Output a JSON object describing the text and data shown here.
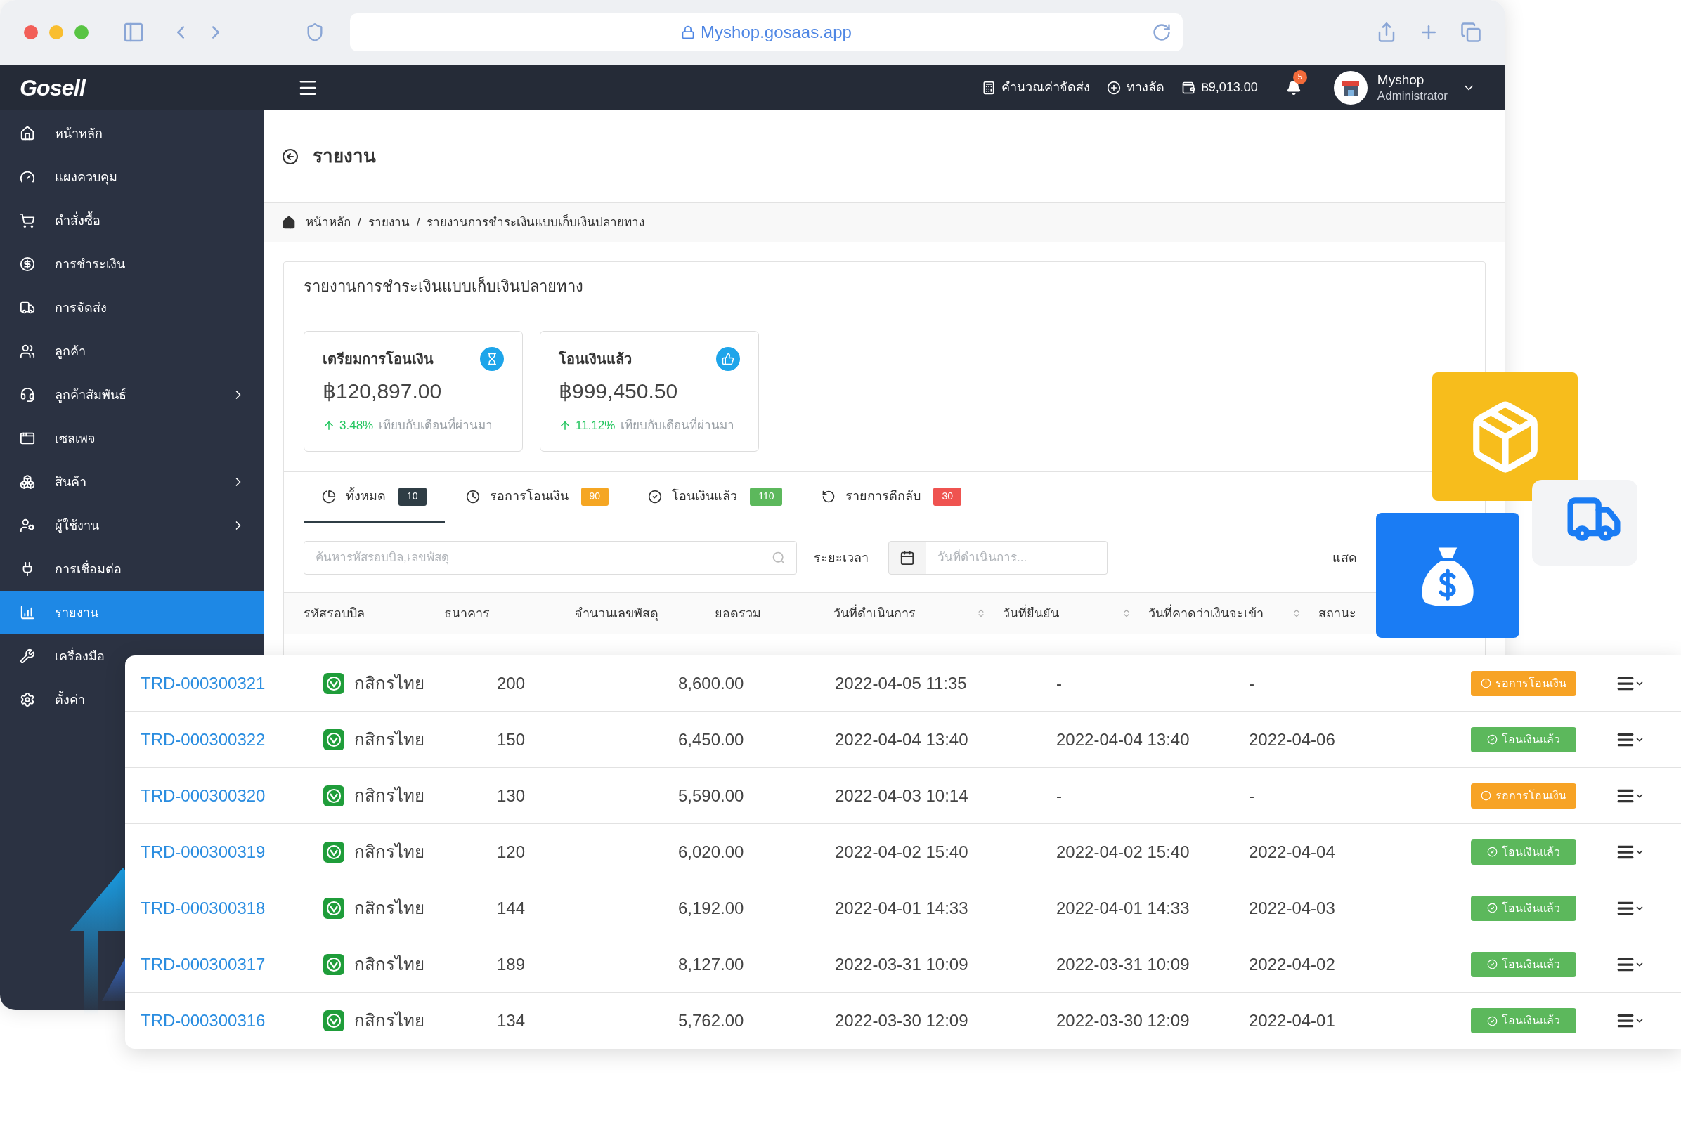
{
  "browser": {
    "url": "Myshop.gosaas.app"
  },
  "header": {
    "logo": "Gosell",
    "actions": [
      {
        "label": "คำนวณค่าจัดส่ง"
      },
      {
        "label": "ทางลัด"
      },
      {
        "label": "฿9,013.00"
      }
    ],
    "notifications": "5",
    "user": {
      "name": "Myshop",
      "role": "Administrator"
    }
  },
  "sidebar": {
    "items": [
      {
        "label": "หน้าหลัก",
        "selected": false,
        "has_submenu": false
      },
      {
        "label": "แผงควบคุม",
        "selected": false,
        "has_submenu": false
      },
      {
        "label": "คำสั่งซื้อ",
        "selected": false,
        "has_submenu": false
      },
      {
        "label": "การชำระเงิน",
        "selected": false,
        "has_submenu": false
      },
      {
        "label": "การจัดส่ง",
        "selected": false,
        "has_submenu": false
      },
      {
        "label": "ลูกค้า",
        "selected": false,
        "has_submenu": false
      },
      {
        "label": "ลูกค้าสัมพันธ์",
        "selected": false,
        "has_submenu": true
      },
      {
        "label": "เซลเพจ",
        "selected": false,
        "has_submenu": false
      },
      {
        "label": "สินค้า",
        "selected": false,
        "has_submenu": true
      },
      {
        "label": "ผู้ใช้งาน",
        "selected": false,
        "has_submenu": true
      },
      {
        "label": "การเชื่อมต่อ",
        "selected": false,
        "has_submenu": false
      },
      {
        "label": "รายงาน",
        "selected": true,
        "has_submenu": false
      },
      {
        "label": "เครื่องมือ",
        "selected": false,
        "has_submenu": false
      },
      {
        "label": "ตั้งค่า",
        "selected": false,
        "has_submenu": false
      }
    ]
  },
  "page": {
    "title": "รายงาน",
    "separator": "/",
    "breadcrumb": [
      "หน้าหลัก",
      "รายงาน",
      "รายงานการชำระเงินแบบเก็บเงินปลายทาง"
    ]
  },
  "report": {
    "title": "รายงานการชำระเงินแบบเก็บเงินปลายทาง",
    "stats": [
      {
        "label": "เตรียมการโอนเงิน",
        "amount": "฿120,897.00",
        "change": "3.48%",
        "comparison": "เทียบกับเดือนที่ผ่านมา"
      },
      {
        "label": "โอนเงินแล้ว",
        "amount": "฿999,450.50",
        "change": "11.12%",
        "comparison": "เทียบกับเดือนที่ผ่านมา"
      }
    ],
    "tabs": [
      {
        "label": "ทั้งหมด",
        "count": "10",
        "color": "#2f3d45",
        "selected": true
      },
      {
        "label": "รอการโอนเงิน",
        "count": "90",
        "color": "#f5a623",
        "selected": false
      },
      {
        "label": "โอนเงินแล้ว",
        "count": "110",
        "color": "#5cb85c",
        "selected": false
      },
      {
        "label": "รายการตีกลับ",
        "count": "30",
        "color": "#ef5350",
        "selected": false
      }
    ],
    "search": {
      "placeholder": "ค้นหารหัสรอบบิล,เลขพัสดุ"
    },
    "period": {
      "label": "ระยะเวลา",
      "placeholder": "วันที่ดำเนินการ..."
    },
    "show_label": "แสด",
    "columns": [
      {
        "label": "รหัสรอบบิล",
        "sortable": false
      },
      {
        "label": "ธนาคาร",
        "sortable": false
      },
      {
        "label": "จำนวนเลขพัสดุ",
        "sortable": false
      },
      {
        "label": "ยอดรวม",
        "sortable": false
      },
      {
        "label": "วันที่ดำเนินการ",
        "sortable": true
      },
      {
        "label": "วันที่ยืนยัน",
        "sortable": true
      },
      {
        "label": "วันที่คาดว่าเงินจะเข้า",
        "sortable": true
      },
      {
        "label": "สถานะ",
        "sortable": false
      }
    ]
  },
  "rows": [
    {
      "id": "TRD-000300321",
      "bank": "กสิกรไทย",
      "parcels": "200",
      "total": "8,600.00",
      "processed": "2022-04-05 11:35",
      "confirmed": "-",
      "expected": "-",
      "status": {
        "kind": "pending",
        "label": "รอการโอนเงิน"
      }
    },
    {
      "id": "TRD-000300322",
      "bank": "กสิกรไทย",
      "parcels": "150",
      "total": "6,450.00",
      "processed": "2022-04-04 13:40",
      "confirmed": "2022-04-04 13:40",
      "expected": "2022-04-06",
      "status": {
        "kind": "transferred",
        "label": "โอนเงินแล้ว"
      }
    },
    {
      "id": "TRD-000300320",
      "bank": "กสิกรไทย",
      "parcels": "130",
      "total": "5,590.00",
      "processed": "2022-04-03 10:14",
      "confirmed": "-",
      "expected": "-",
      "status": {
        "kind": "pending",
        "label": "รอการโอนเงิน"
      }
    },
    {
      "id": "TRD-000300319",
      "bank": "กสิกรไทย",
      "parcels": "120",
      "total": "6,020.00",
      "processed": "2022-04-02 15:40",
      "confirmed": "2022-04-02 15:40",
      "expected": "2022-04-04",
      "status": {
        "kind": "transferred",
        "label": "โอนเงินแล้ว"
      }
    },
    {
      "id": "TRD-000300318",
      "bank": "กสิกรไทย",
      "parcels": "144",
      "total": "6,192.00",
      "processed": "2022-04-01 14:33",
      "confirmed": "2022-04-01 14:33",
      "expected": "2022-04-03",
      "status": {
        "kind": "transferred",
        "label": "โอนเงินแล้ว"
      }
    },
    {
      "id": "TRD-000300317",
      "bank": "กสิกรไทย",
      "parcels": "189",
      "total": "8,127.00",
      "processed": "2022-03-31 10:09",
      "confirmed": "2022-03-31 10:09",
      "expected": "2022-04-02",
      "status": {
        "kind": "transferred",
        "label": "โอนเงินแล้ว"
      }
    },
    {
      "id": "TRD-000300316",
      "bank": "กสิกรไทย",
      "parcels": "134",
      "total": "5,762.00",
      "processed": "2022-03-30 12:09",
      "confirmed": "2022-03-30 12:09",
      "expected": "2022-04-01",
      "status": {
        "kind": "transferred",
        "label": "โอนเงินแล้ว"
      }
    }
  ]
}
